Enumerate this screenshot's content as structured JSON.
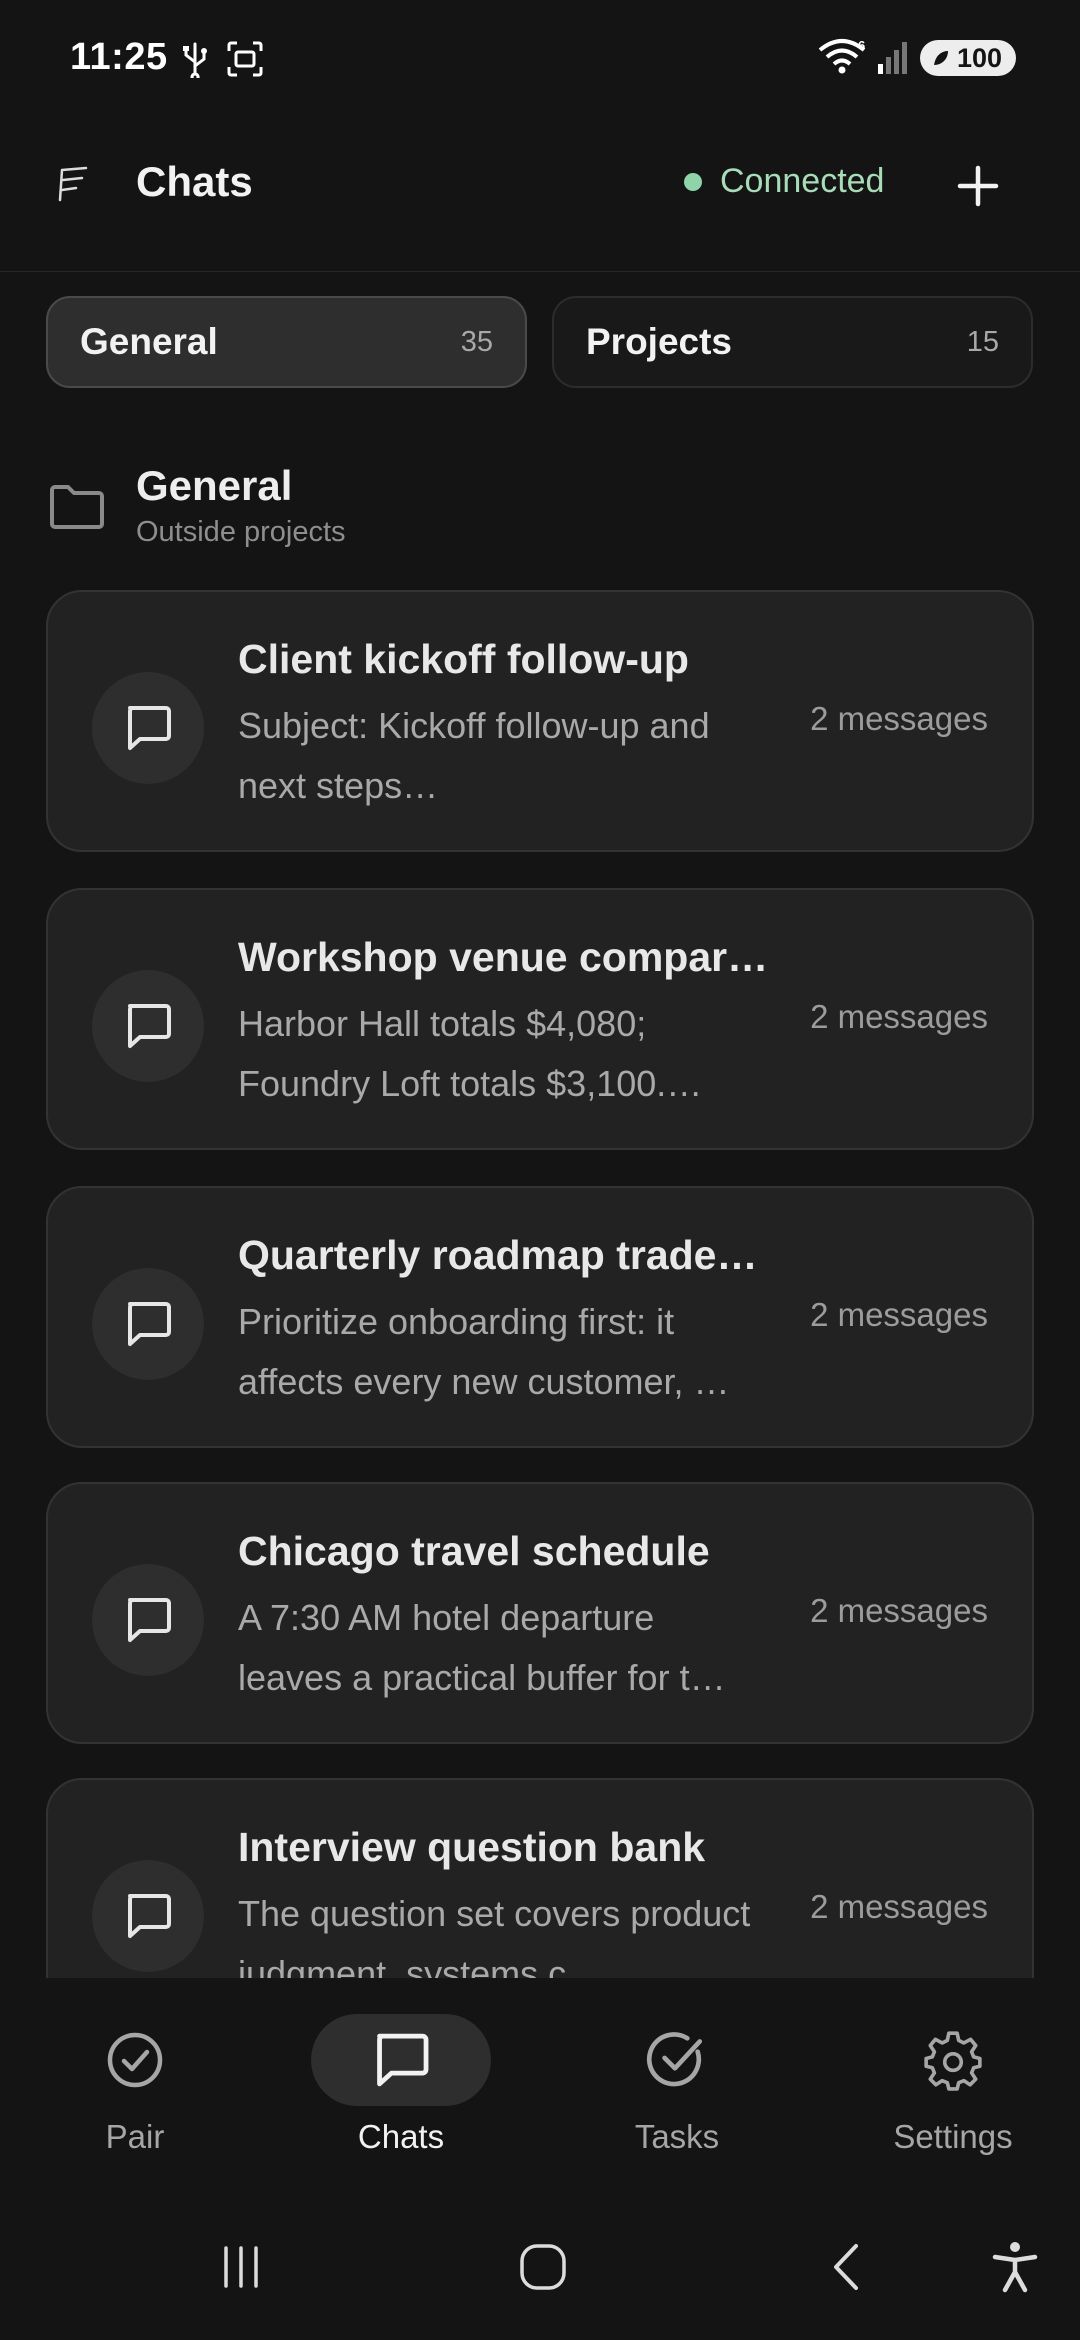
{
  "status_bar": {
    "time": "11:25",
    "battery_level": "100",
    "signal_badge": "6"
  },
  "header": {
    "title": "Chats",
    "connection_status": "Connected",
    "connection_color": "#8fd3a8"
  },
  "tabs": [
    {
      "label": "General",
      "count": "35",
      "selected": true
    },
    {
      "label": "Projects",
      "count": "15",
      "selected": false
    }
  ],
  "section": {
    "title": "General",
    "subtitle": "Outside projects",
    "icon": "folder-icon"
  },
  "chats": [
    {
      "title": "Client kickoff follow-up",
      "preview": "Subject: Kickoff follow-up and next steps…",
      "count": "2 messages"
    },
    {
      "title": "Workshop venue compar…",
      "preview": "Harbor Hall totals $4,080; Foundry Loft totals $3,100.…",
      "count": "2 messages"
    },
    {
      "title": "Quarterly roadmap trade…",
      "preview": "Prioritize onboarding first: it affects every new customer, …",
      "count": "2 messages"
    },
    {
      "title": "Chicago travel schedule",
      "preview": "A 7:30 AM hotel departure leaves a practical buffer for t…",
      "count": "2 messages"
    },
    {
      "title": "Interview question bank",
      "preview": "The question set covers product judgment, systems c…",
      "count": "2 messages"
    }
  ],
  "bottom_nav": [
    {
      "label": "Pair",
      "icon": "check-circle-icon",
      "active": false
    },
    {
      "label": "Chats",
      "icon": "chat-bubble-icon",
      "active": true
    },
    {
      "label": "Tasks",
      "icon": "task-check-icon",
      "active": false
    },
    {
      "label": "Settings",
      "icon": "gear-icon",
      "active": false
    }
  ],
  "system_nav": [
    "recents-icon",
    "home-icon",
    "back-icon",
    "accessibility-icon"
  ]
}
